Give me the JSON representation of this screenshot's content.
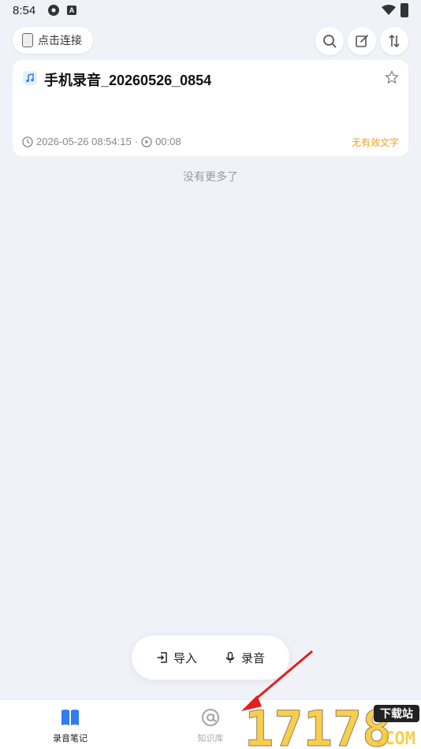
{
  "status_bar": {
    "time": "8:54",
    "b_icon_letter": "A"
  },
  "toolbar": {
    "connect_label": "点击连接"
  },
  "record": {
    "title": "手机录音_20260526_0854",
    "datetime": "2026-05-26 08:54:15",
    "separator": "·",
    "duration": "00:08",
    "status": "无有效文字"
  },
  "list_footer": "没有更多了",
  "actions": {
    "import_label": "导入",
    "record_label": "录音"
  },
  "nav": {
    "items": [
      {
        "label": "录音笔记",
        "icon": "book-icon",
        "active": true
      },
      {
        "label": "知识库",
        "icon": "at-icon",
        "active": false
      }
    ]
  },
  "watermark": {
    "text": "17178",
    "badge": "下载站",
    "domain": ".COM"
  },
  "colors": {
    "accent": "#2f7cf6",
    "warning": "#f0a020",
    "background": "#f1f2f7"
  }
}
